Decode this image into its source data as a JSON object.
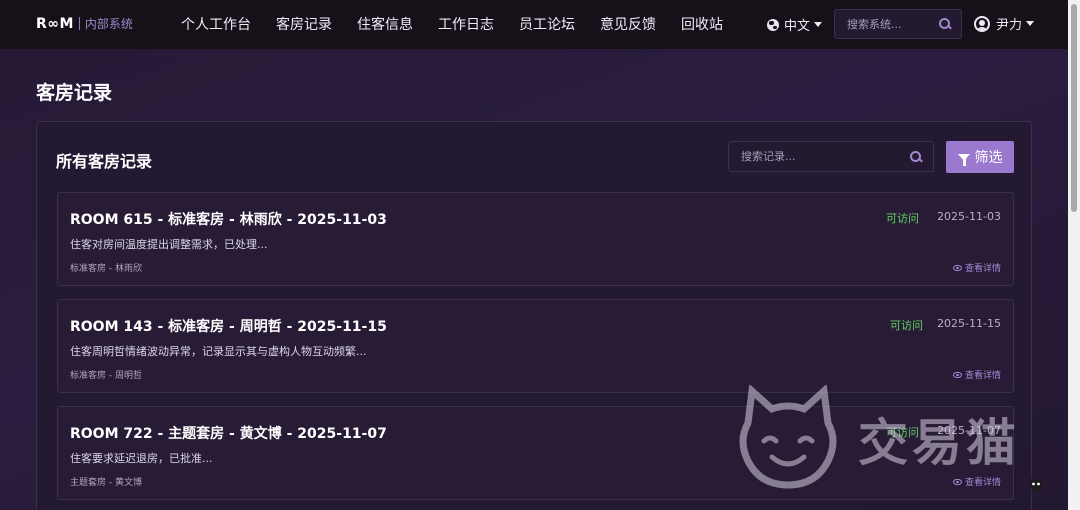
{
  "header": {
    "logo_mark": "R∞M",
    "logo_sub": "内部系统",
    "nav": [
      "个人工作台",
      "客房记录",
      "住客信息",
      "工作日志",
      "员工论坛",
      "意见反馈",
      "回收站"
    ],
    "language": "中文",
    "search_placeholder": "搜索系统...",
    "user_name": "尹力"
  },
  "page": {
    "title": "客房记录"
  },
  "panel": {
    "title": "所有客房记录",
    "search_placeholder": "搜索记录...",
    "filter_label": "筛选"
  },
  "records": [
    {
      "title": "ROOM 615 - 标准客房 - 林雨欣 - 2025-11-03",
      "status": "可访问",
      "date": "2025-11-03",
      "description": "住客对房间温度提出调整需求，已处理...",
      "meta": "标准客房 - 林雨欣",
      "view_label": "查看详情"
    },
    {
      "title": "ROOM 143 - 标准客房 - 周明哲 - 2025-11-15",
      "status": "可访问",
      "date": "2025-11-15",
      "description": "住客周明哲情绪波动异常，记录显示其与虚构人物互动频繁...",
      "meta": "标准客房 - 周明哲",
      "view_label": "查看详情"
    },
    {
      "title": "ROOM 722 - 主题套房 - 黄文博 - 2025-11-07",
      "status": "可访问",
      "date": "2025-11-07",
      "description": "住客要求延迟退房，已批准...",
      "meta": "主题套房 - 黄文博",
      "view_label": "查看详情"
    }
  ],
  "watermark": {
    "text": "交易猫"
  },
  "colors": {
    "accent": "#9a79cf",
    "status_green": "#5fd35f",
    "topbar": "#161019",
    "background": "#2a1c3e"
  }
}
